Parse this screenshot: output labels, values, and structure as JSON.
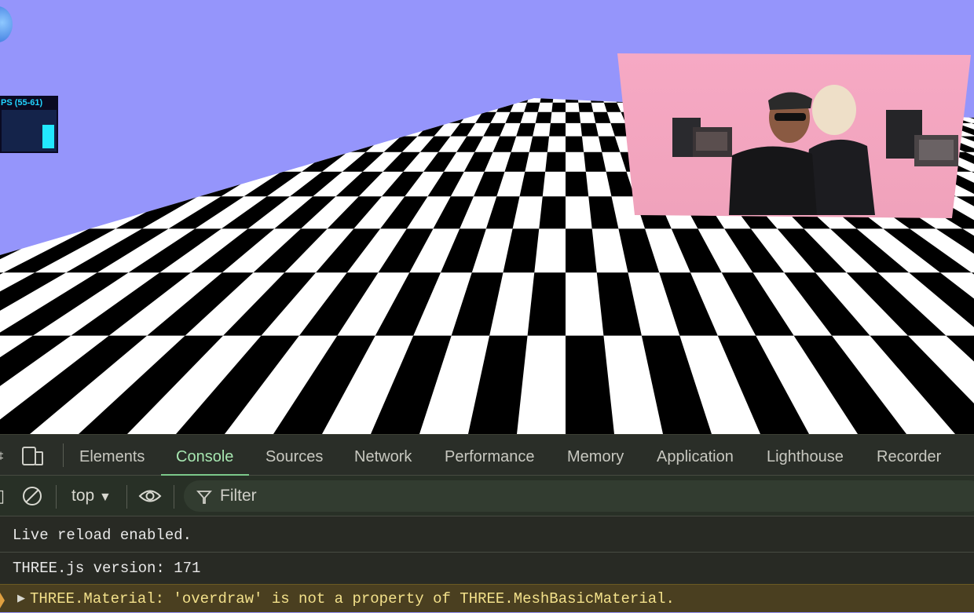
{
  "scene": {
    "sky_color": "#9595fb",
    "stats": {
      "fps_label": "PS (55-61)"
    },
    "video_panel": {
      "bg_color": "#f4a2bd"
    }
  },
  "devtools": {
    "tabs": [
      {
        "label": "Elements",
        "active": false
      },
      {
        "label": "Console",
        "active": true
      },
      {
        "label": "Sources",
        "active": false
      },
      {
        "label": "Network",
        "active": false
      },
      {
        "label": "Performance",
        "active": false
      },
      {
        "label": "Memory",
        "active": false
      },
      {
        "label": "Application",
        "active": false
      },
      {
        "label": "Lighthouse",
        "active": false
      },
      {
        "label": "Recorder",
        "active": false
      }
    ],
    "toolbar": {
      "context": "top",
      "filter_placeholder": "Filter"
    },
    "console": {
      "messages": [
        {
          "level": "log",
          "text": "Live reload enabled."
        },
        {
          "level": "log",
          "text": "THREE.js version: 171"
        },
        {
          "level": "warning",
          "text": "THREE.Material: 'overdraw' is not a property of THREE.MeshBasicMaterial."
        }
      ]
    }
  }
}
